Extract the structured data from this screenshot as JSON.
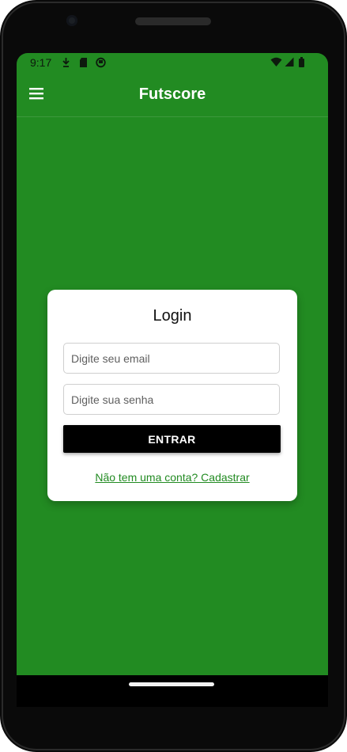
{
  "status_bar": {
    "time": "9:17",
    "icons": [
      "download-arrow-icon",
      "sd-card-icon",
      "shield-app-icon",
      "wifi-icon",
      "cell-signal-icon",
      "battery-icon"
    ]
  },
  "app_bar": {
    "title": "Futscore",
    "menu_icon": "hamburger-menu-icon",
    "background_color": "#228b22"
  },
  "login_card": {
    "title": "Login",
    "email": {
      "placeholder": "Digite seu email",
      "value": ""
    },
    "password": {
      "placeholder": "Digite sua senha",
      "value": ""
    },
    "submit_label": "ENTRAR",
    "signup_link": "Não tem uma conta? Cadastrar"
  },
  "colors": {
    "primary": "#228b22",
    "button": "#000000",
    "card": "#ffffff"
  }
}
